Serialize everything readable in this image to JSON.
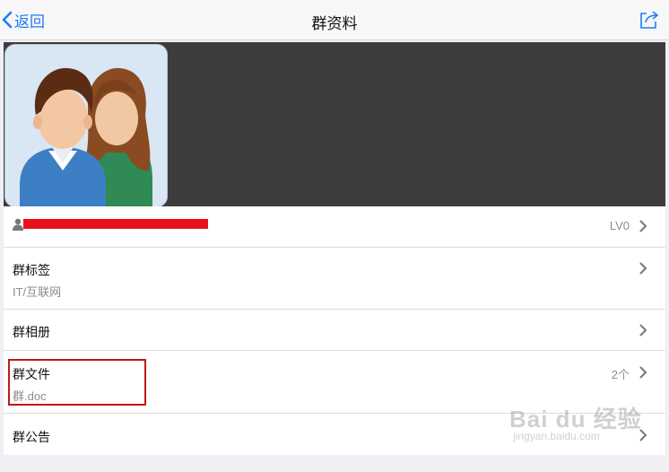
{
  "navbar": {
    "back_label": "返回",
    "title": "群资料"
  },
  "members_row": {
    "level": "LV0"
  },
  "rows": {
    "tags": {
      "title": "群标签",
      "subtitle": "IT/互联网"
    },
    "album": {
      "title": "群相册"
    },
    "files": {
      "title": "群文件",
      "subtitle": "群.doc",
      "count": "2个"
    },
    "notice": {
      "title": "群公告"
    }
  },
  "watermark": {
    "brand": "Bai du 经验",
    "url": "jingyan.baidu.com"
  },
  "colors": {
    "accent": "#1f7bf6",
    "highlight": "#c01818",
    "redaction": "#e8101a",
    "hero_bg": "#3d3d3d"
  }
}
